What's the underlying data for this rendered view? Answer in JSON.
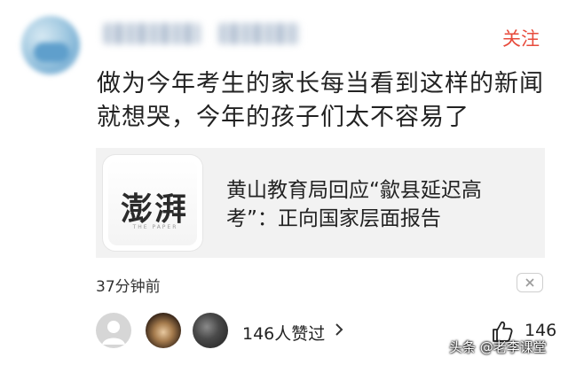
{
  "header": {
    "follow_label": "关注"
  },
  "comment": {
    "text": "做为今年考生的家长每当看到这样的新闻就想哭，今年的孩子们太不容易了"
  },
  "article": {
    "logo_text": "澎湃",
    "logo_sub": "THE PAPER",
    "title": "黄山教育局回应“歙县延迟高考”：正向国家层面报告"
  },
  "meta": {
    "timestamp": "37分钟前"
  },
  "likes": {
    "summary": "146人赞过",
    "count": "146"
  },
  "watermark": {
    "text": "头条 @老李课堂"
  },
  "colors": {
    "follow": "#e74b3c",
    "card_background": "#f2f2f2"
  },
  "icons": {
    "dismiss": "close-icon",
    "chevron": "chevron-right-icon",
    "like": "thumbs-up-icon"
  }
}
